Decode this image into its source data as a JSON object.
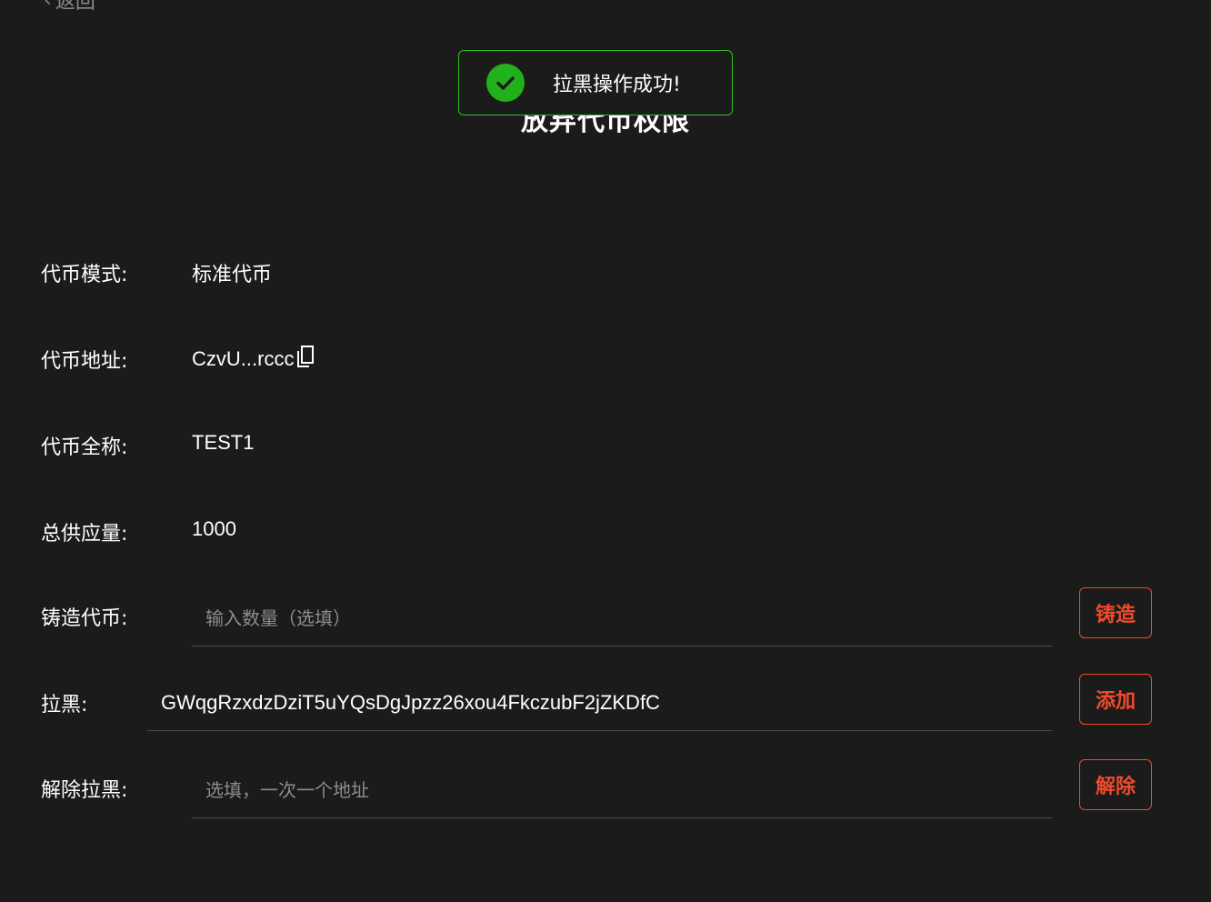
{
  "back": {
    "label": "返回"
  },
  "page": {
    "title": "放弃代币权限"
  },
  "toast": {
    "message": "拉黑操作成功!",
    "accent": "#21b11a"
  },
  "info": {
    "mode": {
      "label": "代币模式:",
      "value": "标准代币"
    },
    "address": {
      "label": "代币地址:",
      "value": "CzvU...rccc"
    },
    "name": {
      "label": "代币全称:",
      "value": "TEST1"
    },
    "supply": {
      "label": "总供应量:",
      "value": "1000"
    }
  },
  "mint": {
    "label": "铸造代币:",
    "placeholder": "输入数量（选填）",
    "button": "铸造"
  },
  "blacklist": {
    "label": "拉黑:",
    "value": "GWqgRzxdzDziT5uYQsDgJpzz26xou4FkczubF2jZKDfC",
    "button": "添加"
  },
  "unblacklist": {
    "label": "解除拉黑:",
    "placeholder": "选填，一次一个地址",
    "button": "解除"
  },
  "colors": {
    "background": "#1b1b1b",
    "button": "#f04a2c",
    "success": "#2fbf1f"
  }
}
